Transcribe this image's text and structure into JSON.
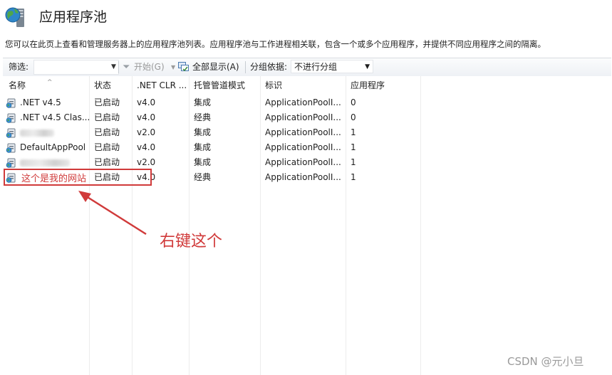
{
  "page": {
    "title": "应用程序池",
    "description": "您可以在此页上查看和管理服务器上的应用程序池列表。应用程序池与工作进程相关联，包含一个或多个应用程序，并提供不同应用程序之间的隔离。"
  },
  "toolbar": {
    "filter_label": "筛选:",
    "start_label": "开始(G)",
    "show_all_label": "全部显示(A)",
    "group_by_label": "分组依据:",
    "group_by_value": "不进行分组"
  },
  "table": {
    "columns": [
      "名称",
      "状态",
      ".NET CLR ...",
      "托管管道模式",
      "标识",
      "应用程序"
    ],
    "rows": [
      {
        "name": ".NET v4.5",
        "status": "已启动",
        "clr": "v4.0",
        "pipeline": "集成",
        "identity": "ApplicationPoolI...",
        "apps": "0",
        "blurred": false
      },
      {
        "name": ".NET v4.5 Clas...",
        "status": "已启动",
        "clr": "v4.0",
        "pipeline": "经典",
        "identity": "ApplicationPoolI...",
        "apps": "0",
        "blurred": false
      },
      {
        "name": "",
        "status": "已启动",
        "clr": "v2.0",
        "pipeline": "集成",
        "identity": "ApplicationPoolI...",
        "apps": "1",
        "blurred": true
      },
      {
        "name": "DefaultAppPool",
        "status": "已启动",
        "clr": "v4.0",
        "pipeline": "集成",
        "identity": "ApplicationPoolI...",
        "apps": "1",
        "blurred": false
      },
      {
        "name": "",
        "status": "已启动",
        "clr": "v2.0",
        "pipeline": "集成",
        "identity": "ApplicationPoolI...",
        "apps": "1",
        "blurred": true
      },
      {
        "name": "",
        "status": "已启动",
        "clr": "v4.0",
        "pipeline": "经典",
        "identity": "ApplicationPoolI...",
        "apps": "1",
        "blurred": false
      }
    ]
  },
  "annotations": {
    "site_name": "这个是我的网站",
    "right_click_hint": "右键这个",
    "watermark": "CSDN @元小旦"
  },
  "colors": {
    "annotation": "#d03a3a",
    "toolbar": "#eef1f5"
  },
  "icons": {
    "header": "iis-globe-server-icon",
    "pool": "app-pool-icon",
    "start": "funnel-start-icon",
    "show_all": "show-all-icon"
  }
}
